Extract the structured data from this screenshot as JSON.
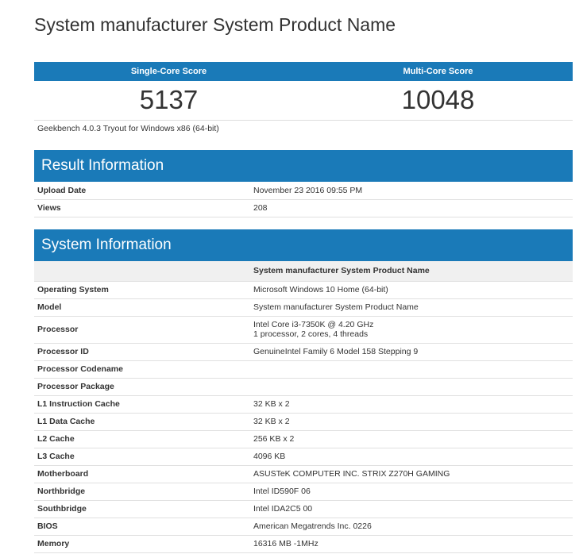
{
  "page": {
    "title": "System manufacturer System Product Name"
  },
  "scores": {
    "single_label": "Single-Core Score",
    "multi_label": "Multi-Core Score",
    "single_value": "5137",
    "multi_value": "10048",
    "version": "Geekbench 4.0.3 Tryout for Windows x86 (64-bit)"
  },
  "result": {
    "title": "Result Information",
    "rows": [
      {
        "k": "Upload Date",
        "v": "November 23 2016 09:55 PM"
      },
      {
        "k": "Views",
        "v": "208"
      }
    ]
  },
  "system": {
    "title": "System Information",
    "subheader": "System manufacturer System Product Name",
    "rows": [
      {
        "k": "Operating System",
        "v": "Microsoft Windows 10 Home (64-bit)"
      },
      {
        "k": "Model",
        "v": "System manufacturer System Product Name"
      },
      {
        "k": "Processor",
        "v": "Intel Core i3-7350K @ 4.20 GHz",
        "v2": "1 processor, 2 cores, 4 threads"
      },
      {
        "k": "Processor ID",
        "v": "GenuineIntel Family 6 Model 158 Stepping 9"
      },
      {
        "k": "Processor Codename",
        "v": ""
      },
      {
        "k": "Processor Package",
        "v": ""
      },
      {
        "k": "L1 Instruction Cache",
        "v": "32 KB x 2"
      },
      {
        "k": "L1 Data Cache",
        "v": "32 KB x 2"
      },
      {
        "k": "L2 Cache",
        "v": "256 KB x 2"
      },
      {
        "k": "L3 Cache",
        "v": "4096 KB"
      },
      {
        "k": "Motherboard",
        "v": "ASUSTeK COMPUTER INC. STRIX Z270H GAMING"
      },
      {
        "k": "Northbridge",
        "v": "Intel ID590F 06"
      },
      {
        "k": "Southbridge",
        "v": "Intel IDA2C5 00"
      },
      {
        "k": "BIOS",
        "v": "American Megatrends Inc. 0226"
      },
      {
        "k": "Memory",
        "v": "16316 MB -1MHz"
      }
    ]
  },
  "colors": {
    "accent": "#1a7ab8"
  }
}
